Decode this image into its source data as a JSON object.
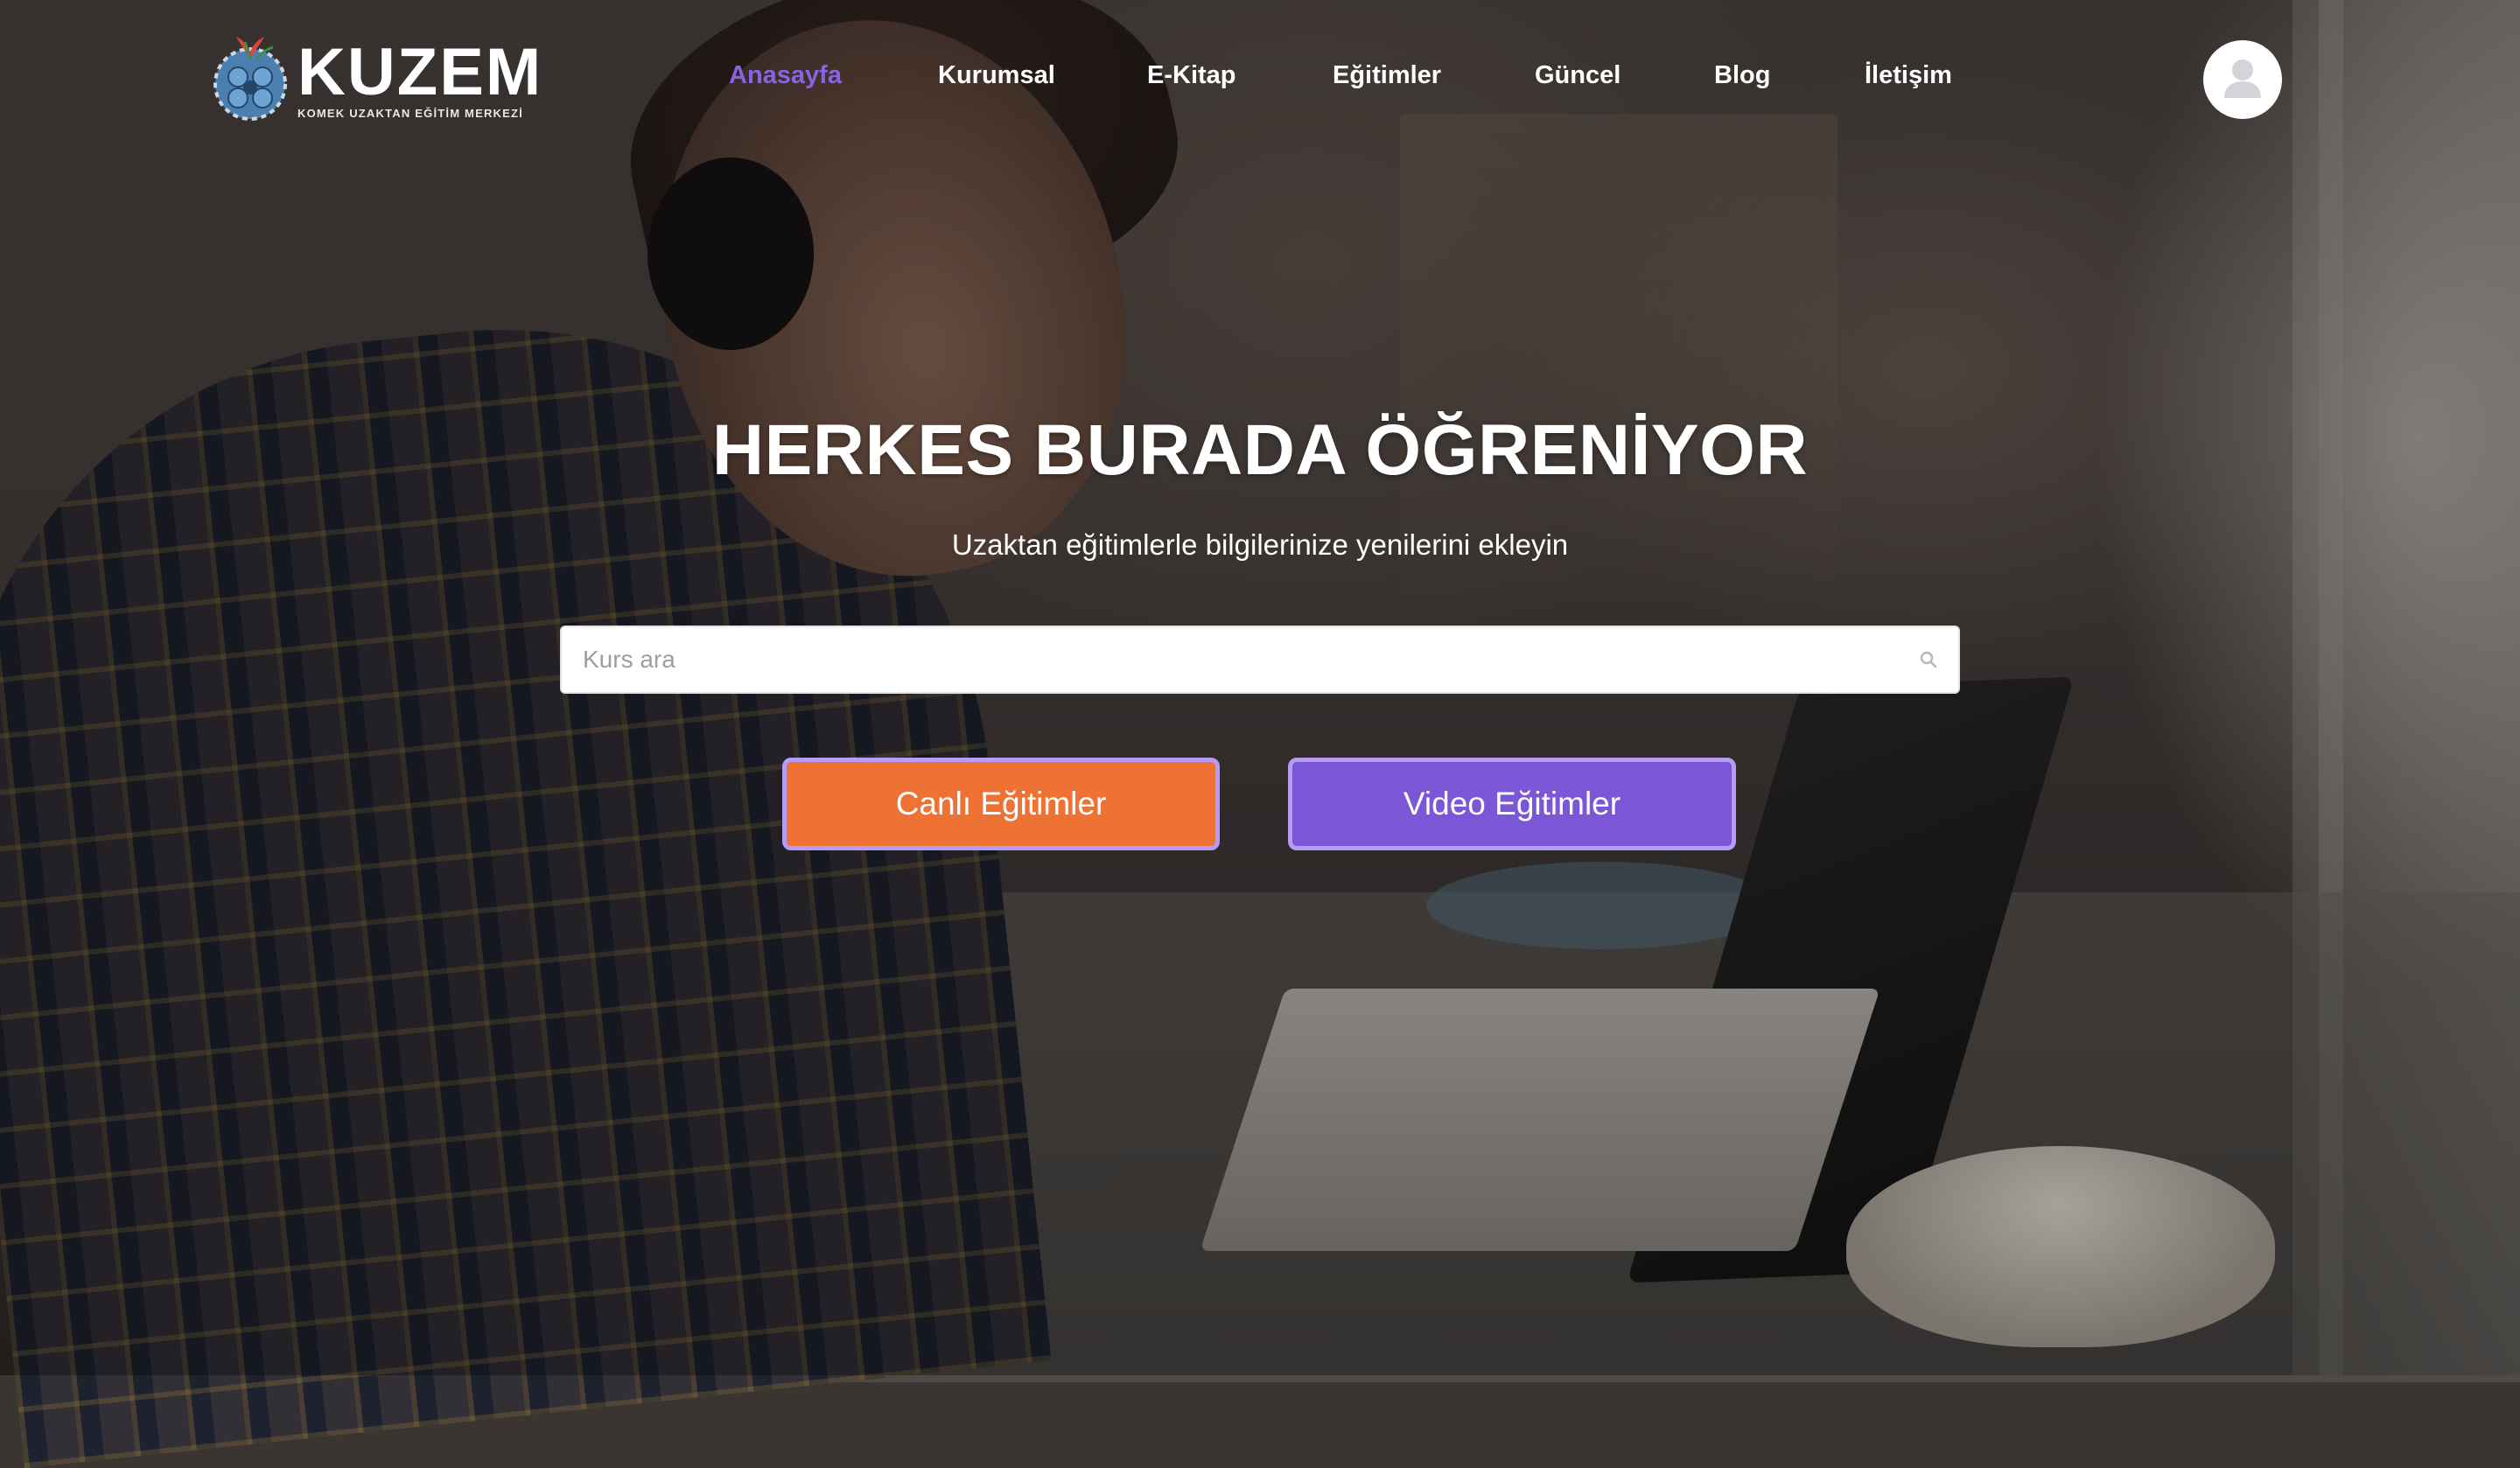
{
  "brand": {
    "name": "KUZEM",
    "tagline": "KOMEK UZAKTAN EĞİTİM MERKEZİ",
    "colors": {
      "primary": "#7b56d6",
      "accent": "#ee7233",
      "nav_active": "#8a63e3"
    }
  },
  "nav": {
    "items": [
      {
        "label": "Anasayfa",
        "active": true
      },
      {
        "label": "Kurumsal",
        "active": false
      },
      {
        "label": "E-Kitap",
        "active": false
      },
      {
        "label": "Eğitimler",
        "active": false
      },
      {
        "label": "Güncel",
        "active": false
      },
      {
        "label": "Blog",
        "active": false
      },
      {
        "label": "İletişim",
        "active": false
      }
    ],
    "avatar_icon": "user-icon"
  },
  "hero": {
    "title": "HERKES BURADA ÖĞRENİYOR",
    "subtitle": "Uzaktan eğitimlerle bilgilerinize yenilerini ekleyin",
    "search": {
      "placeholder": "Kurs ara",
      "value": "",
      "icon": "search-icon"
    },
    "buttons": {
      "live": "Canlı Eğitimler",
      "video": "Video Eğitimler"
    }
  }
}
